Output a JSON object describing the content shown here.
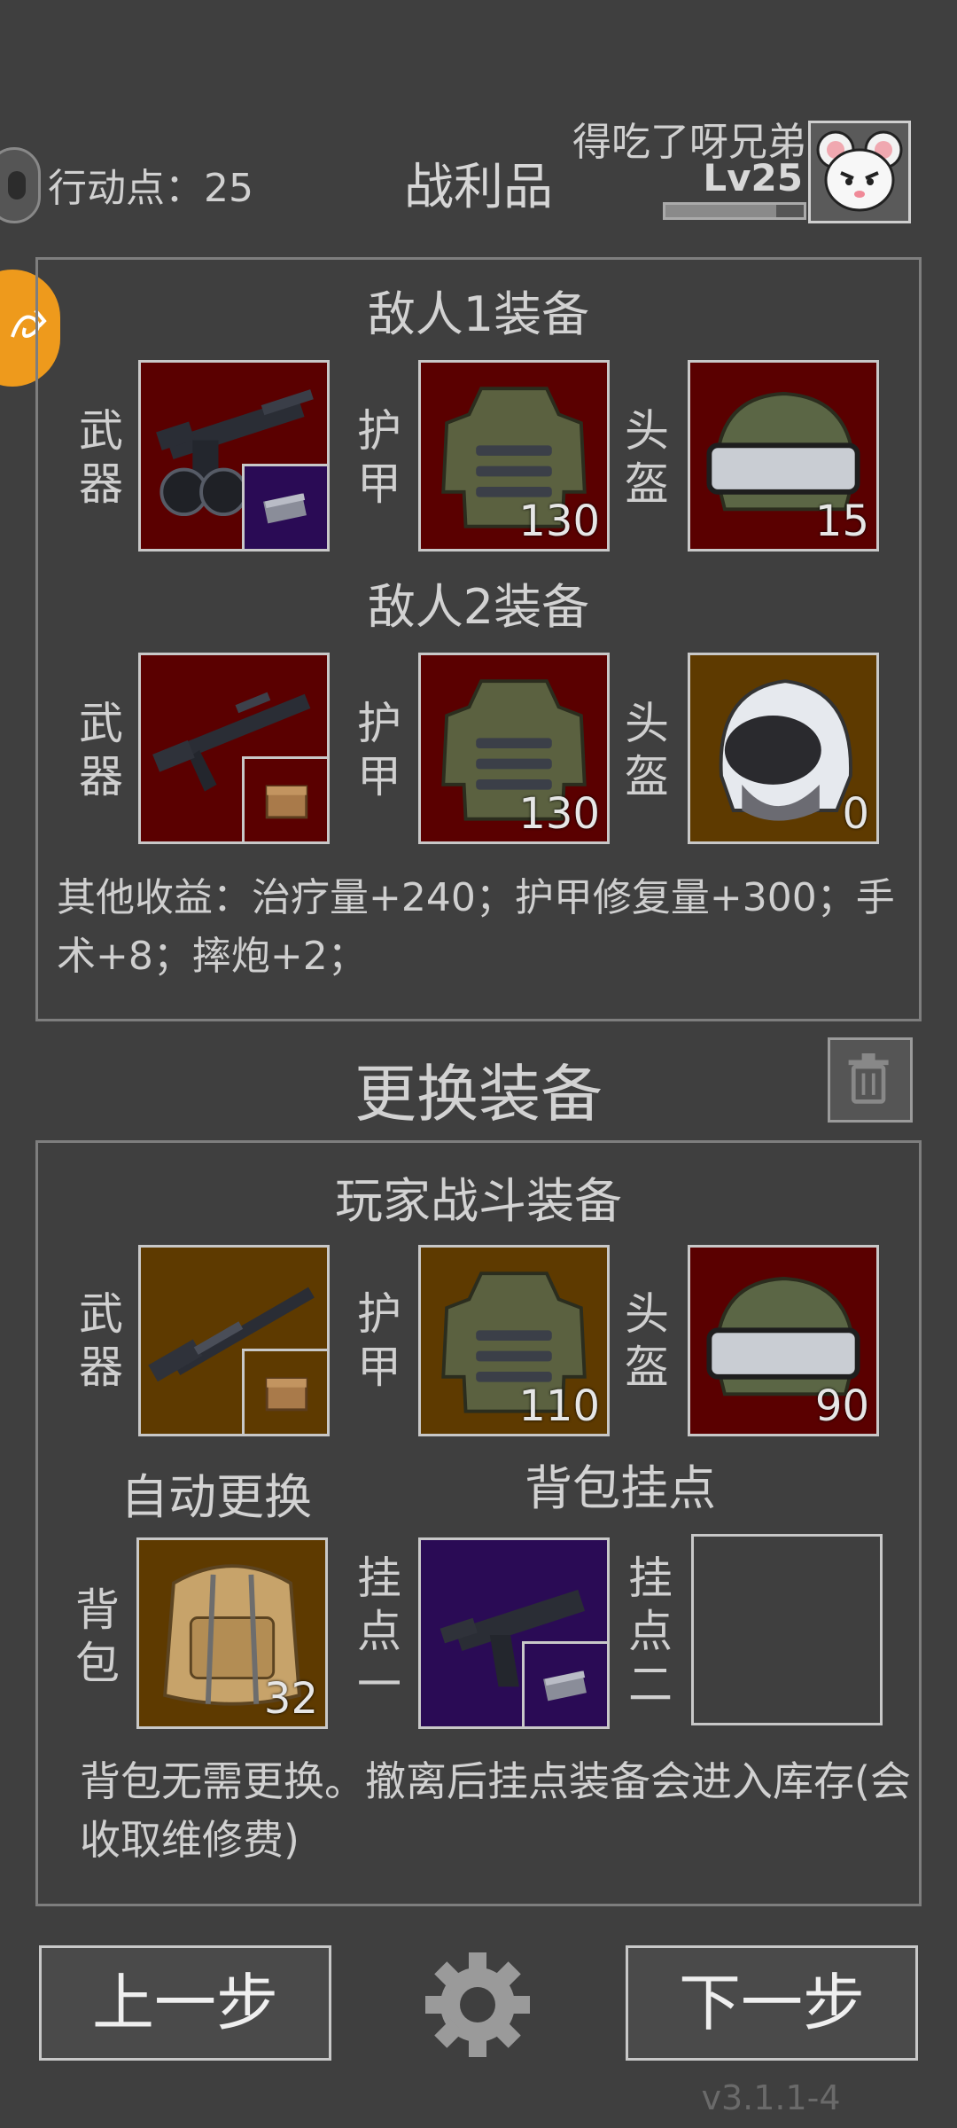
{
  "header": {
    "action_points_label": "行动点：25",
    "title": "战利品",
    "player_name": "得吃了呀兄弟",
    "level": "Lv25"
  },
  "loot": {
    "enemy1_title": "敌人1装备",
    "enemy2_title": "敌人2装备",
    "weapon_label": "武\n器",
    "armor_label": "护\n甲",
    "helmet_label": "头\n盔",
    "enemy1": {
      "armor_value": "130",
      "helmet_value": "15"
    },
    "enemy2": {
      "armor_value": "130",
      "helmet_value": "0"
    },
    "other_gains": "其他收益：治疗量+240；护甲修复量+300；手术+8；摔炮+2；"
  },
  "change": {
    "title": "更换装备",
    "player_title": "玩家战斗装备",
    "weapon_label": "武\n器",
    "armor_label": "护\n甲",
    "helmet_label": "头\n盔",
    "armor_value": "110",
    "helmet_value": "90",
    "auto_replace": "自动更换",
    "backpack_mounts": "背包挂点",
    "backpack_label": "背\n包",
    "backpack_value": "32",
    "mount1_label": "挂\n点\n一",
    "mount2_label": "挂\n点\n二",
    "note": "背包无需更换。撤离后挂点装备会进入库存(会收取维修费)"
  },
  "footer": {
    "prev_label": "上一步",
    "next_label": "下一步",
    "version": "v3.1.1-4"
  },
  "icons": [
    "discord-like-icon",
    "orange-swirl-icon",
    "mouse-avatar-icon",
    "trash-icon",
    "gear-icon"
  ]
}
